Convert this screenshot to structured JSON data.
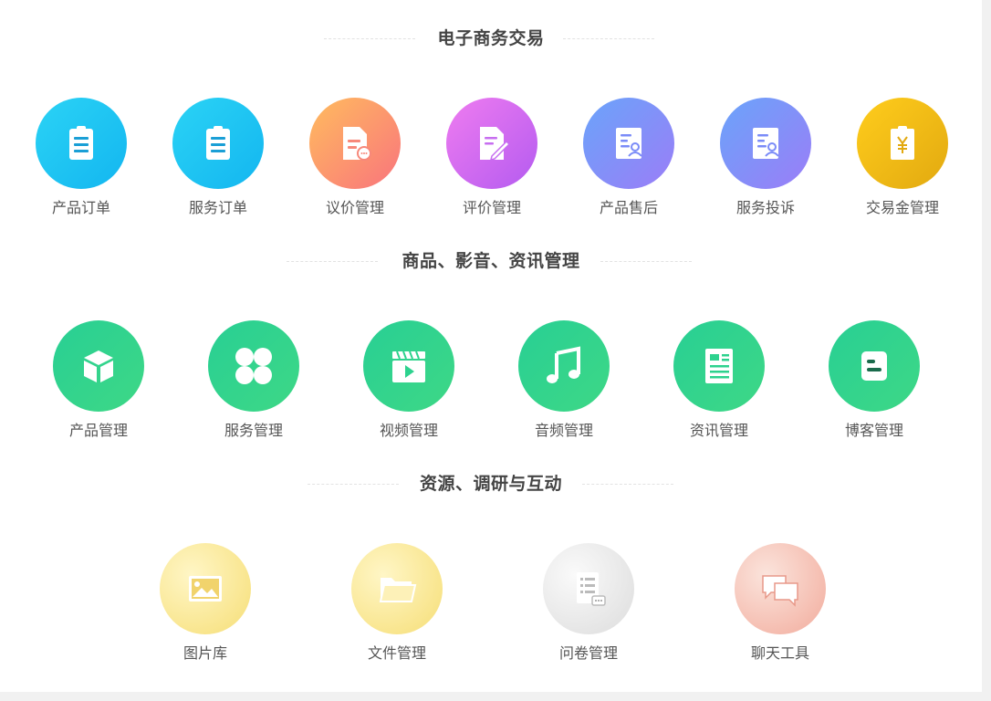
{
  "sections": [
    {
      "title": "电子商务交易",
      "items": [
        {
          "label": "产品订单",
          "icon": "clipboard-icon"
        },
        {
          "label": "服务订单",
          "icon": "clipboard-icon"
        },
        {
          "label": "议价管理",
          "icon": "document-chat-icon"
        },
        {
          "label": "评价管理",
          "icon": "document-edit-icon"
        },
        {
          "label": "产品售后",
          "icon": "document-user-icon"
        },
        {
          "label": "服务投诉",
          "icon": "document-user-icon"
        },
        {
          "label": "交易金管理",
          "icon": "yuan-clipboard-icon"
        }
      ]
    },
    {
      "title": "商品、影音、资讯管理",
      "items": [
        {
          "label": "产品管理",
          "icon": "box-icon"
        },
        {
          "label": "服务管理",
          "icon": "clover-icon"
        },
        {
          "label": "视频管理",
          "icon": "video-clapper-icon"
        },
        {
          "label": "音频管理",
          "icon": "music-note-icon"
        },
        {
          "label": "资讯管理",
          "icon": "newspaper-icon"
        },
        {
          "label": "博客管理",
          "icon": "blog-icon"
        }
      ]
    },
    {
      "title": "资源、调研与互动",
      "items": [
        {
          "label": "图片库",
          "icon": "image-icon"
        },
        {
          "label": "文件管理",
          "icon": "folder-icon"
        },
        {
          "label": "问卷管理",
          "icon": "questionnaire-icon"
        },
        {
          "label": "聊天工具",
          "icon": "chat-bubbles-icon"
        }
      ]
    }
  ],
  "colors": {
    "cyan": "#13b6f0",
    "orange": "#f9747d",
    "pink": "#b45bf0",
    "blue": "#7b8cf8",
    "gold": "#e2a910",
    "green": "#2dd28e",
    "title_text": "#444444",
    "label_text": "#555555"
  }
}
